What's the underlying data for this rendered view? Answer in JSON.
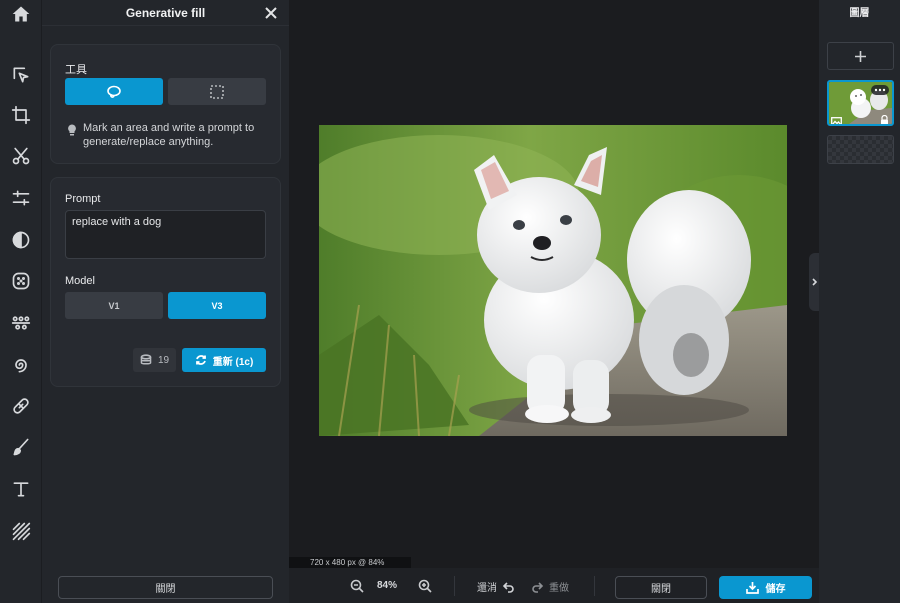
{
  "colors": {
    "accent": "#0a97d0",
    "panel": "#23262b",
    "canvas_bg": "#1b1c1f"
  },
  "rail": {
    "icons": [
      "home-icon",
      "select-arrow-icon",
      "crop-icon",
      "cut-icon",
      "adjust-sliders-icon",
      "contrast-icon",
      "filter-dots-icon",
      "effects-icon",
      "liquify-swirl-icon",
      "bandage-heal-icon",
      "brush-icon",
      "text-icon",
      "pattern-icon"
    ]
  },
  "panel": {
    "title": "Generative fill",
    "tool": {
      "label": "工具",
      "options": [
        {
          "icon": "lasso-icon",
          "selected": true
        },
        {
          "icon": "rect-select-icon",
          "selected": false
        }
      ],
      "hint": "Mark an area and write a prompt to generate/replace anything."
    },
    "prompt": {
      "label": "Prompt",
      "value": "replace with a dog"
    },
    "model": {
      "label": "Model",
      "options": [
        "V1",
        "V3"
      ],
      "selected": "V3"
    },
    "credits": "19",
    "regenerate_label": "重新 (1c)",
    "close_label": "關閉"
  },
  "canvas": {
    "image_alt": "white dog walking on a path",
    "size_readout": "720 x 480 px @ 84%"
  },
  "bottombar": {
    "zoom": "84%",
    "undo_label": "還消",
    "redo_label": "重做",
    "close_label": "關閉",
    "save_label": "儲存"
  },
  "layers": {
    "title": "圖層"
  }
}
